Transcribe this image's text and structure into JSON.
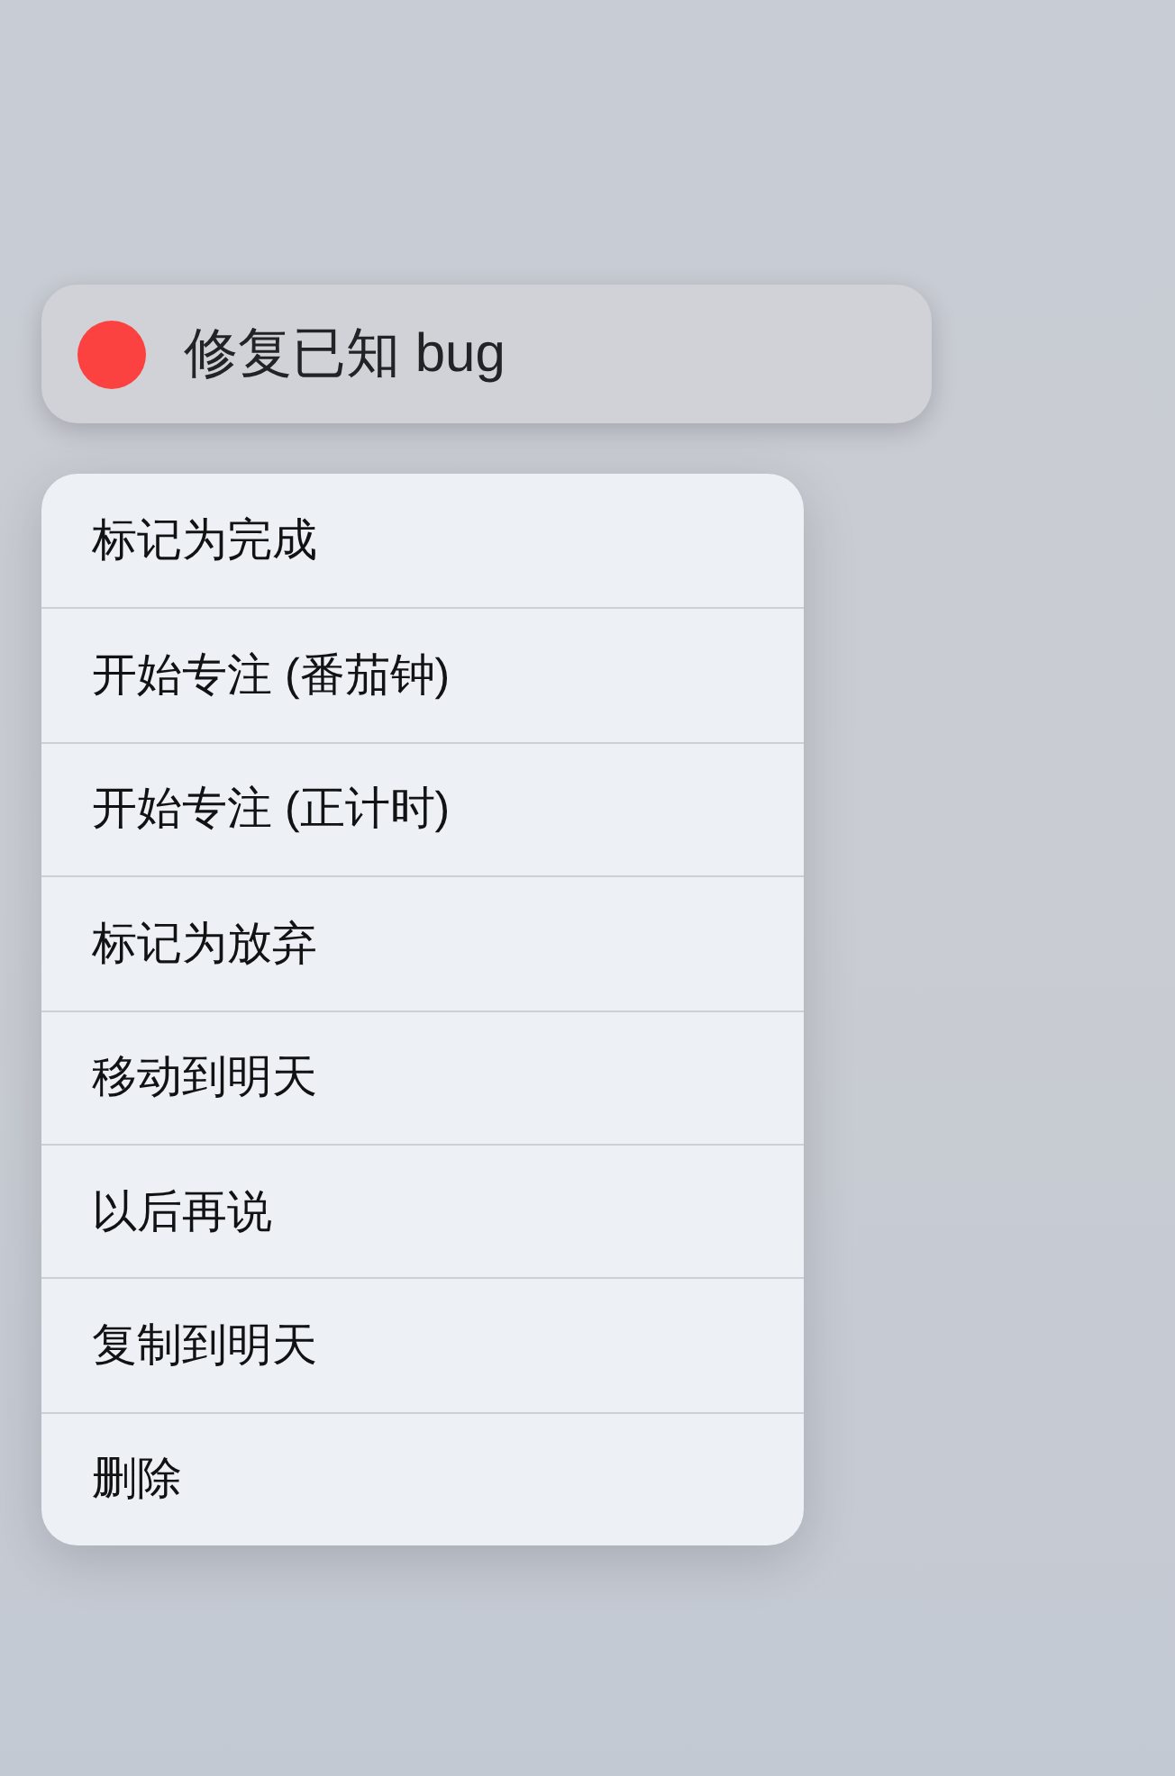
{
  "task": {
    "title": "修复已知 bug",
    "color": "#fc4240"
  },
  "menu": {
    "items": [
      {
        "label": "标记为完成"
      },
      {
        "label": "开始专注 (番茄钟)"
      },
      {
        "label": "开始专注 (正计时)"
      },
      {
        "label": "标记为放弃"
      },
      {
        "label": "移动到明天"
      },
      {
        "label": "以后再说"
      },
      {
        "label": "复制到明天"
      },
      {
        "label": "删除"
      }
    ]
  }
}
